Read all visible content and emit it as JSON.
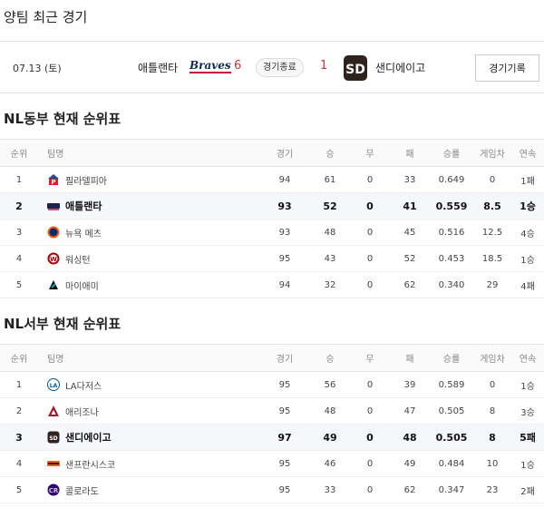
{
  "recent": {
    "title": "양팀 최근 경기",
    "date": "07.13 (토)",
    "home_team": "애틀랜타",
    "home_logo_text": "Braves",
    "home_score": "6",
    "status": "경기종료",
    "away_score": "1",
    "away_team": "샌디에이고",
    "record_button": "경기기록"
  },
  "headers": [
    "순위",
    "팀명",
    "경기",
    "승",
    "무",
    "패",
    "승률",
    "게임차",
    "연속"
  ],
  "east": {
    "title": "NL동부 현재 순위표",
    "rows": [
      {
        "rank": "1",
        "team": "필라델피아",
        "logo": "phillies-logo",
        "g": "94",
        "w": "61",
        "d": "0",
        "l": "33",
        "pct": "0.649",
        "gb": "0",
        "st": "1패",
        "hl": false
      },
      {
        "rank": "2",
        "team": "애틀랜타",
        "logo": "braves-logo",
        "g": "93",
        "w": "52",
        "d": "0",
        "l": "41",
        "pct": "0.559",
        "gb": "8.5",
        "st": "1승",
        "hl": true
      },
      {
        "rank": "3",
        "team": "뉴욕 메츠",
        "logo": "mets-logo",
        "g": "93",
        "w": "48",
        "d": "0",
        "l": "45",
        "pct": "0.516",
        "gb": "12.5",
        "st": "4승",
        "hl": false
      },
      {
        "rank": "4",
        "team": "워싱턴",
        "logo": "nationals-logo",
        "g": "95",
        "w": "43",
        "d": "0",
        "l": "52",
        "pct": "0.453",
        "gb": "18.5",
        "st": "1승",
        "hl": false
      },
      {
        "rank": "5",
        "team": "마이애미",
        "logo": "marlins-logo",
        "g": "94",
        "w": "32",
        "d": "0",
        "l": "62",
        "pct": "0.340",
        "gb": "29",
        "st": "4패",
        "hl": false
      }
    ]
  },
  "west": {
    "title": "NL서부 현재 순위표",
    "rows": [
      {
        "rank": "1",
        "team": "LA다저스",
        "logo": "dodgers-logo",
        "g": "95",
        "w": "56",
        "d": "0",
        "l": "39",
        "pct": "0.589",
        "gb": "0",
        "st": "1승",
        "hl": false
      },
      {
        "rank": "2",
        "team": "애리조나",
        "logo": "diamondbacks-logo",
        "g": "95",
        "w": "48",
        "d": "0",
        "l": "47",
        "pct": "0.505",
        "gb": "8",
        "st": "3승",
        "hl": false
      },
      {
        "rank": "3",
        "team": "샌디에이고",
        "logo": "padres-logo",
        "g": "97",
        "w": "49",
        "d": "0",
        "l": "48",
        "pct": "0.505",
        "gb": "8",
        "st": "5패",
        "hl": true
      },
      {
        "rank": "4",
        "team": "샌프란시스코",
        "logo": "giants-logo",
        "g": "95",
        "w": "46",
        "d": "0",
        "l": "49",
        "pct": "0.484",
        "gb": "10",
        "st": "1승",
        "hl": false
      },
      {
        "rank": "5",
        "team": "콜로라도",
        "logo": "rockies-logo",
        "g": "95",
        "w": "33",
        "d": "0",
        "l": "62",
        "pct": "0.347",
        "gb": "23",
        "st": "2패",
        "hl": false
      }
    ]
  },
  "colors": {
    "score": "#e03030",
    "highlight_row": "#f5f7fa"
  }
}
